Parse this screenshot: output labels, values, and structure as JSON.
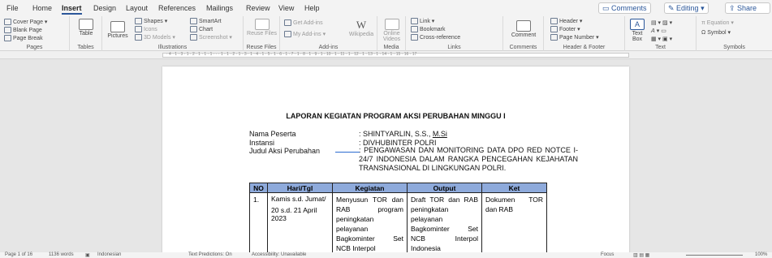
{
  "tabs": [
    "File",
    "Home",
    "Insert",
    "Design",
    "Layout",
    "References",
    "Mailings",
    "Review",
    "View",
    "Help"
  ],
  "active_tab": "Insert",
  "header_buttons": {
    "comments": "Comments",
    "editing": "Editing",
    "share": "Share"
  },
  "ribbon": {
    "pages": {
      "label": "Pages",
      "items": [
        "Cover Page",
        "Blank Page",
        "Page Break"
      ]
    },
    "tables": {
      "label": "Tables",
      "item": "Table"
    },
    "illustrations": {
      "label": "Illustrations",
      "pictures": "Pictures",
      "items": [
        "Shapes",
        "Icons",
        "3D Models",
        "SmartArt",
        "Chart",
        "Screenshot"
      ]
    },
    "reuse": {
      "label": "Reuse Files",
      "item": "Reuse Files"
    },
    "addins": {
      "label": "Add-ins",
      "items": [
        "Get Add-ins",
        "My Add-ins"
      ],
      "wiki": "Wikipedia"
    },
    "media": {
      "label": "Media",
      "item": "Online Videos"
    },
    "links": {
      "label": "Links",
      "items": [
        "Link",
        "Bookmark",
        "Cross-reference"
      ]
    },
    "comments": {
      "label": "Comments",
      "item": "Comment"
    },
    "hf": {
      "label": "Header & Footer",
      "items": [
        "Header",
        "Footer",
        "Page Number"
      ]
    },
    "text": {
      "label": "Text",
      "item": "Text Box"
    },
    "symbols": {
      "label": "Symbols",
      "items": [
        "Equation",
        "Symbol"
      ]
    }
  },
  "ruler": "· 4 · 1 · 3 · 1 · 2 · 1 · 1 · 1 · · · 1 · 1 · 2 · 1 · 3 · 1 · 4 · 1 · 5 · 1 · 6 · 1 · 7 · 1 · 8 · 1 · 9 · 1 · 10 · 1 · 11 · 1 · 12 · 1 · 13 · 1 · 14 · 1 · 15 · 16 · 17",
  "doc": {
    "title": "LAPORAN KEGIATAN PROGRAM AKSI PERUBAHAN MINGGU I",
    "rows": [
      {
        "label": "Nama Peserta",
        "value_a": ": SHINTYARLIN, S.S., ",
        "value_b": "M.Si"
      },
      {
        "label": "Instansi",
        "value_a": ": DIVHUBINTER POLRI",
        "value_b": ""
      },
      {
        "label": "Judul Aksi Perubahan",
        "value_a": ": PENGAWASAN DAN MONITORING DATA DPO RED NOTCE I-24/7 INDONESIA DALAM RANGKA PENCEGAHAN KEJAHATAN TRANSNASIONAL DI LINGKUNGAN POLRI.",
        "value_b": ""
      }
    ],
    "table": {
      "headers": [
        "NO",
        "Hari/Tgl",
        "Kegiatan",
        "Output",
        "Ket"
      ],
      "row": {
        "no": "1.",
        "hari": "Kamis s.d. Jumat/",
        "tgl": "20 s.d. 21 April 2023",
        "kegiatan": "Menyusun TOR dan RAB program peningkatan pelayanan Bagkominter Set NCB Interpol",
        "output": "Draft TOR dan RAB peningkatan pelayanan Bagkominter Set NCB Interpol Indonesia",
        "ket": "Dokumen TOR dan RAB"
      }
    }
  },
  "status": {
    "page": "Page 1 of 16",
    "words": "1136 words",
    "lang": "Indonesian",
    "predict": "Text Predictions: On",
    "access": "Accessibility: Unavailable",
    "focus": "Focus",
    "zoom": "100%"
  }
}
